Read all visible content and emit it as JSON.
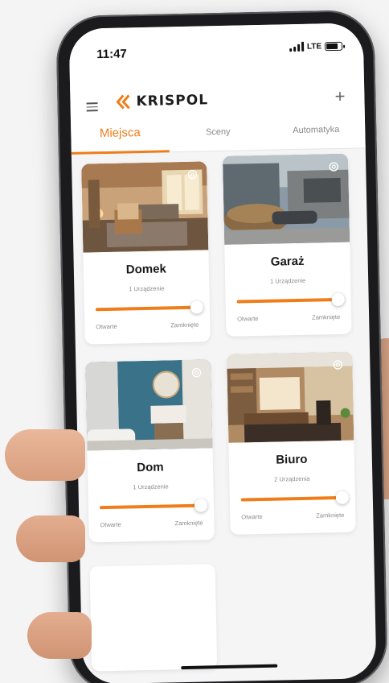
{
  "status_bar": {
    "time": "11:47",
    "network": "LTE"
  },
  "header": {
    "brand": "KRISPOL",
    "menu_icon": "menu-icon",
    "add_icon": "plus-icon"
  },
  "tabs": [
    {
      "label": "Miejsca",
      "active": true
    },
    {
      "label": "Sceny",
      "active": false
    },
    {
      "label": "Automatyka",
      "active": false
    }
  ],
  "places": [
    {
      "name": "Domek",
      "devices": "1 Urządzenie",
      "open_label": "Otwarte",
      "closed_label": "Zamknięte",
      "position": 1.0,
      "image": "living-room"
    },
    {
      "name": "Garaż",
      "devices": "1 Urządzenie",
      "open_label": "Otwarte",
      "closed_label": "Zamknięte",
      "position": 1.0,
      "image": "garage"
    },
    {
      "name": "Dom",
      "devices": "1 Urządzenie",
      "open_label": "Otwarte",
      "closed_label": "Zamknięte",
      "position": 1.0,
      "image": "bathroom"
    },
    {
      "name": "Biuro",
      "devices": "2 Urządzenia",
      "open_label": "Otwarte",
      "closed_label": "Zamknięte",
      "position": 1.0,
      "image": "office"
    }
  ],
  "colors": {
    "accent": "#f07d1a",
    "text": "#1a1a1a",
    "muted": "#8a8a8a"
  }
}
